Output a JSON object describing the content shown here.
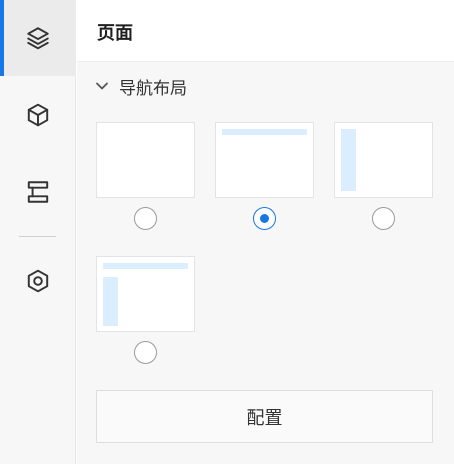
{
  "sidebar": {
    "items": [
      {
        "icon": "layers-icon",
        "active": true
      },
      {
        "icon": "cube-icon",
        "active": false
      },
      {
        "icon": "layout-component-icon",
        "active": false
      },
      {
        "icon": "hexagon-settings-icon",
        "active": false
      }
    ]
  },
  "panel": {
    "title": "页面",
    "section": {
      "title": "导航布局",
      "expanded": true,
      "layouts": [
        {
          "variant": "blank",
          "selected": false
        },
        {
          "variant": "top-nav",
          "selected": true
        },
        {
          "variant": "side-nav",
          "selected": false
        },
        {
          "variant": "top-and-side-nav",
          "selected": false
        }
      ]
    },
    "config_label": "配置"
  },
  "colors": {
    "accent": "#1677e5",
    "nav_fill": "#dbeeff"
  }
}
